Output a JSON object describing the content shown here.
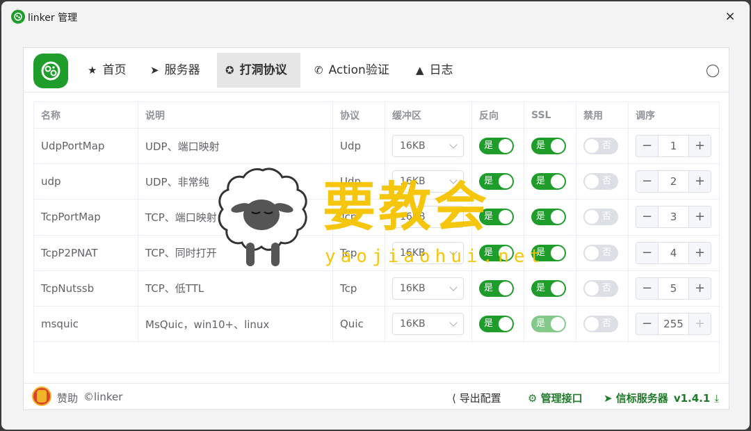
{
  "window": {
    "title": "linker 管理",
    "close_icon": "×"
  },
  "nav": {
    "items": [
      {
        "icon": "★",
        "label": "首页",
        "active": false
      },
      {
        "icon": "➤",
        "label": "服务器",
        "active": false
      },
      {
        "icon": "✪",
        "label": "打洞协议",
        "active": true
      },
      {
        "icon": "✆",
        "label": "Action验证",
        "active": false
      },
      {
        "icon": "▲",
        "label": "日志",
        "active": false
      }
    ]
  },
  "table": {
    "headers": [
      "名称",
      "说明",
      "协议",
      "缓冲区",
      "反向",
      "SSL",
      "禁用",
      "调序"
    ],
    "switch_on_label": "是",
    "switch_off_label": "否",
    "rows": [
      {
        "name": "UdpPortMap",
        "desc": "UDP、端口映射",
        "protocol": "Udp",
        "buffer": "16KB",
        "reverse": true,
        "ssl": true,
        "disabled": false,
        "order": "1"
      },
      {
        "name": "udp",
        "desc": "UDP、非常纯",
        "protocol": "Udp",
        "buffer": "16KB",
        "reverse": true,
        "ssl": true,
        "disabled": false,
        "order": "2"
      },
      {
        "name": "TcpPortMap",
        "desc": "TCP、端口映射",
        "protocol": "Tcp",
        "buffer": "16KB",
        "reverse": true,
        "ssl": true,
        "disabled": false,
        "order": "3"
      },
      {
        "name": "TcpP2PNAT",
        "desc": "TCP、同时打开",
        "protocol": "Tcp",
        "buffer": "16KB",
        "reverse": true,
        "ssl": true,
        "disabled": false,
        "order": "4"
      },
      {
        "name": "TcpNutssb",
        "desc": "TCP、低TTL",
        "protocol": "Tcp",
        "buffer": "16KB",
        "reverse": true,
        "ssl": true,
        "disabled": false,
        "order": "5"
      },
      {
        "name": "msquic",
        "desc": "MsQuic，win10+、linux",
        "protocol": "Quic",
        "buffer": "16KB",
        "reverse": true,
        "ssl": true,
        "disabled": false,
        "order": "255"
      }
    ]
  },
  "footer": {
    "sponsor": "赞助",
    "copyright": "©linker",
    "export_config": "导出配置",
    "manage_api": "管理接口",
    "signal_server": "信标服务器",
    "version": "v1.4.1"
  },
  "watermark": {
    "text": "要教会",
    "url": "yaojiaohui.net"
  },
  "colors": {
    "accent": "#1f9d2b",
    "watermark": "#f5c400"
  }
}
